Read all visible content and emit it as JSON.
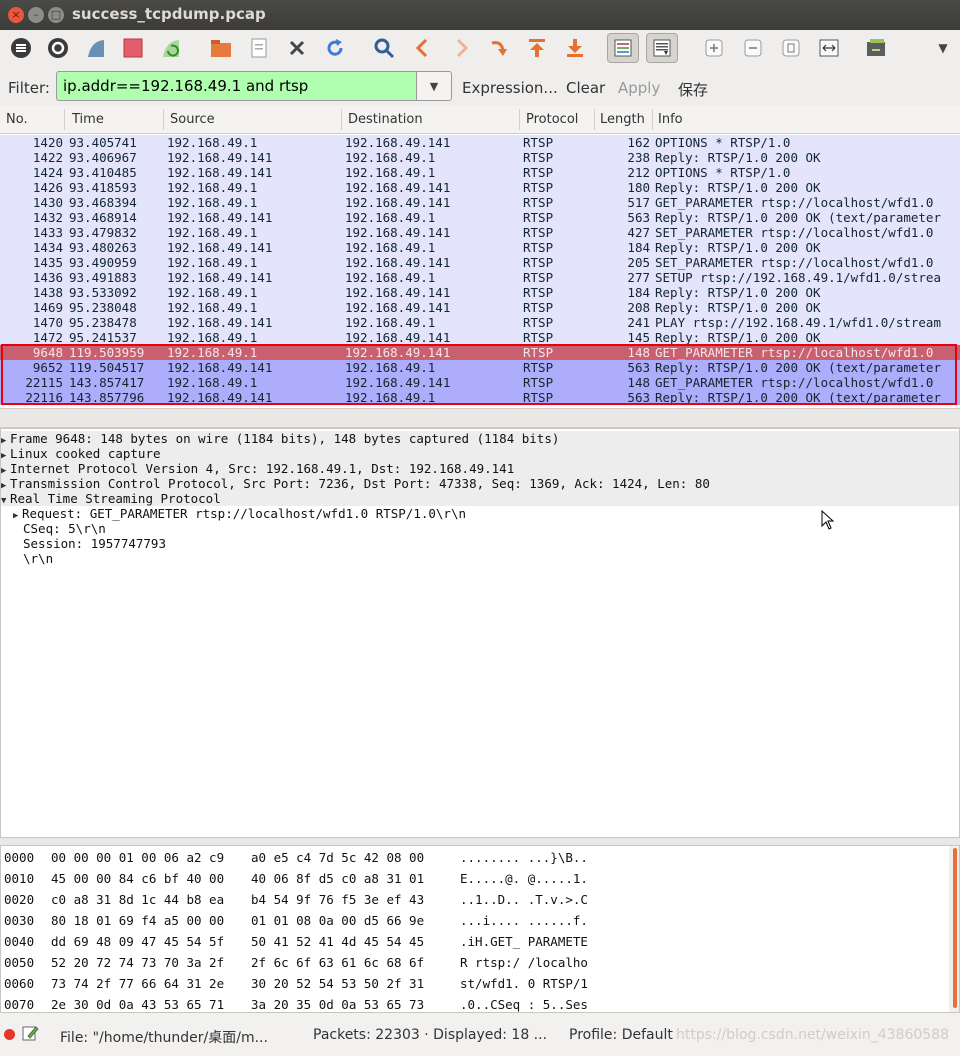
{
  "window": {
    "title": "success_tcpdump.pcap"
  },
  "filter": {
    "label": "Filter:",
    "value": "ip.addr==192.168.49.1 and rtsp",
    "expression": "Expression...",
    "clear": "Clear",
    "apply": "Apply",
    "save": "保存"
  },
  "packet_list": {
    "columns": [
      "No.",
      "Time",
      "Source",
      "Destination",
      "Protocol",
      "Length",
      "Info"
    ],
    "rows": [
      [
        "1420",
        "93.405741",
        "192.168.49.1",
        "192.168.49.141",
        "RTSP",
        "162",
        "OPTIONS * RTSP/1.0"
      ],
      [
        "1422",
        "93.406967",
        "192.168.49.141",
        "192.168.49.1",
        "RTSP",
        "238",
        "Reply: RTSP/1.0 200 OK"
      ],
      [
        "1424",
        "93.410485",
        "192.168.49.141",
        "192.168.49.1",
        "RTSP",
        "212",
        "OPTIONS * RTSP/1.0"
      ],
      [
        "1426",
        "93.418593",
        "192.168.49.1",
        "192.168.49.141",
        "RTSP",
        "180",
        "Reply: RTSP/1.0 200 OK"
      ],
      [
        "1430",
        "93.468394",
        "192.168.49.1",
        "192.168.49.141",
        "RTSP",
        "517",
        "GET_PARAMETER rtsp://localhost/wfd1.0"
      ],
      [
        "1432",
        "93.468914",
        "192.168.49.141",
        "192.168.49.1",
        "RTSP",
        "563",
        "Reply: RTSP/1.0 200 OK (text/parameter"
      ],
      [
        "1433",
        "93.479832",
        "192.168.49.1",
        "192.168.49.141",
        "RTSP",
        "427",
        "SET_PARAMETER rtsp://localhost/wfd1.0"
      ],
      [
        "1434",
        "93.480263",
        "192.168.49.141",
        "192.168.49.1",
        "RTSP",
        "184",
        "Reply: RTSP/1.0 200 OK"
      ],
      [
        "1435",
        "93.490959",
        "192.168.49.1",
        "192.168.49.141",
        "RTSP",
        "205",
        "SET_PARAMETER rtsp://localhost/wfd1.0"
      ],
      [
        "1436",
        "93.491883",
        "192.168.49.141",
        "192.168.49.1",
        "RTSP",
        "277",
        "SETUP rtsp://192.168.49.1/wfd1.0/strea"
      ],
      [
        "1438",
        "93.533092",
        "192.168.49.1",
        "192.168.49.141",
        "RTSP",
        "184",
        "Reply: RTSP/1.0 200 OK"
      ],
      [
        "1469",
        "95.238048",
        "192.168.49.1",
        "192.168.49.141",
        "RTSP",
        "208",
        "Reply: RTSP/1.0 200 OK"
      ],
      [
        "1470",
        "95.238478",
        "192.168.49.141",
        "192.168.49.1",
        "RTSP",
        "241",
        "PLAY rtsp://192.168.49.1/wfd1.0/stream"
      ],
      [
        "1472",
        "95.241537",
        "192.168.49.1",
        "192.168.49.141",
        "RTSP",
        "145",
        "Reply: RTSP/1.0 200 OK"
      ],
      [
        "9648",
        "119.503959",
        "192.168.49.1",
        "192.168.49.141",
        "RTSP",
        "148",
        "GET_PARAMETER rtsp://localhost/wfd1.0"
      ],
      [
        "9652",
        "119.504517",
        "192.168.49.141",
        "192.168.49.1",
        "RTSP",
        "563",
        "Reply: RTSP/1.0 200 OK (text/parameter"
      ],
      [
        "22115",
        "143.857417",
        "192.168.49.1",
        "192.168.49.141",
        "RTSP",
        "148",
        "GET_PARAMETER rtsp://localhost/wfd1.0"
      ],
      [
        "22116",
        "143.857796",
        "192.168.49.141",
        "192.168.49.1",
        "RTSP",
        "563",
        "Reply: RTSP/1.0 200 OK (text/parameter"
      ]
    ]
  },
  "details": [
    "Frame 9648: 148 bytes on wire (1184 bits), 148 bytes captured (1184 bits)",
    "Linux cooked capture",
    "Internet Protocol Version 4, Src: 192.168.49.1, Dst: 192.168.49.141",
    "Transmission Control Protocol, Src Port: 7236, Dst Port: 47338, Seq: 1369, Ack: 1424, Len: 80",
    "Real Time Streaming Protocol",
    "Request: GET_PARAMETER rtsp://localhost/wfd1.0 RTSP/1.0\\r\\n",
    "CSeq: 5\\r\\n",
    "Session: 1957747793",
    "\\r\\n"
  ],
  "bytes": [
    [
      "0000",
      "00 00 00 01 00 06 a2 c9",
      "a0 e5 c4 7d 5c 42 08 00",
      "........ ...}\\B.."
    ],
    [
      "0010",
      "45 00 00 84 c6 bf 40 00",
      "40 06 8f d5 c0 a8 31 01",
      "E.....@. @.....1."
    ],
    [
      "0020",
      "c0 a8 31 8d 1c 44 b8 ea",
      "b4 54 9f 76 f5 3e ef 43",
      "..1..D.. .T.v.>.C"
    ],
    [
      "0030",
      "80 18 01 69 f4 a5 00 00",
      "01 01 08 0a 00 d5 66 9e",
      "...i.... ......f."
    ],
    [
      "0040",
      "dd 69 48 09 47 45 54 5f",
      "50 41 52 41 4d 45 54 45",
      ".iH.GET_ PARAMETE"
    ],
    [
      "0050",
      "52 20 72 74 73 70 3a 2f",
      "2f 6c 6f 63 61 6c 68 6f",
      "R rtsp:/ /localho"
    ],
    [
      "0060",
      "73 74 2f 77 66 64 31 2e",
      "30 20 52 54 53 50 2f 31",
      "st/wfd1. 0 RTSP/1"
    ],
    [
      "0070",
      "2e 30 0d 0a 43 53 65 71",
      "3a 20 35 0d 0a 53 65 73",
      ".0..CSeq : 5..Ses"
    ]
  ],
  "status": {
    "file": "File: \"/home/thunder/桌面/m...",
    "packets": "Packets: 22303 · Displayed: 18 ...",
    "profile": "Profile: Default",
    "watermark": "https://blog.csdn.net/weixin_43860588"
  },
  "colors": {
    "filter_valid": "#afffaf",
    "row_default": "#e4e4fc",
    "row_selected": "#c9606f",
    "row_marked": "#adadfb",
    "highlight_box": "#e8000b"
  }
}
